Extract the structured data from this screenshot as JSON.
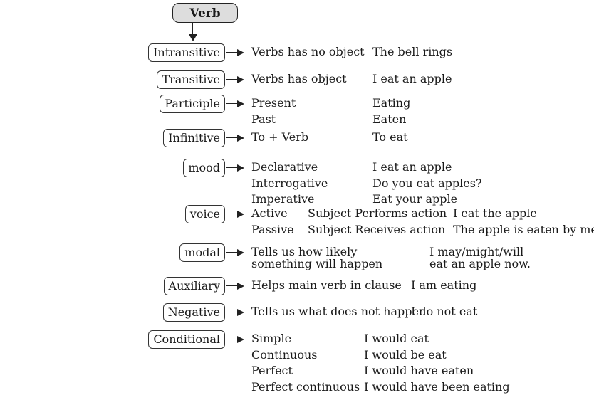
{
  "root": {
    "label": "Verb"
  },
  "nodes": [
    {
      "label": "Intransitive",
      "rows": [
        [
          "Verbs has no object",
          "The bell rings"
        ]
      ]
    },
    {
      "label": "Transitive",
      "rows": [
        [
          "Verbs has object",
          "I eat an apple"
        ]
      ]
    },
    {
      "label": "Participle",
      "rows": [
        [
          "Present",
          "Eating"
        ],
        [
          "Past",
          "Eaten"
        ]
      ]
    },
    {
      "label": "Infinitive",
      "rows": [
        [
          "To + Verb",
          "To eat"
        ]
      ]
    },
    {
      "label": "mood",
      "rows": [
        [
          "Declarative",
          "I eat an apple"
        ],
        [
          "Interrogative",
          "Do you eat apples?"
        ],
        [
          "Imperative",
          "Eat your apple"
        ]
      ]
    },
    {
      "label": "voice",
      "rows": [
        [
          "Active",
          "Subject Performs action",
          "I eat the apple"
        ],
        [
          "Passive",
          "Subject Receives action",
          "The apple is eaten by me."
        ]
      ]
    },
    {
      "label": "modal",
      "rows": [
        [
          "Tells us how likely",
          "I may/might/will"
        ],
        [
          "something will happen",
          "eat an apple now."
        ]
      ]
    },
    {
      "label": "Auxiliary",
      "rows": [
        [
          "Helps main verb in clause",
          "I am eating"
        ]
      ]
    },
    {
      "label": "Negative",
      "rows": [
        [
          "Tells us what does not happen",
          "I do not eat"
        ]
      ]
    },
    {
      "label": "Conditional",
      "rows": [
        [
          "Simple",
          "I would eat"
        ],
        [
          "Continuous",
          "I would be eat"
        ],
        [
          "Perfect",
          "I would have eaten"
        ],
        [
          "Perfect continuous",
          "I would have been eating"
        ]
      ]
    }
  ]
}
